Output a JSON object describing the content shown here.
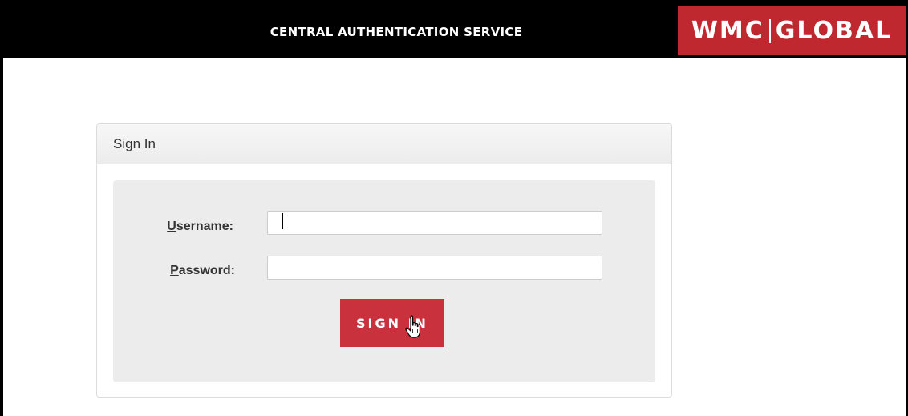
{
  "header": {
    "title": "CENTRAL AUTHENTICATION SERVICE",
    "logo_left": "WMC",
    "logo_right": "GLOBAL",
    "logo_color": "#c0282f"
  },
  "panel": {
    "heading": "Sign In"
  },
  "form": {
    "username_label_key": "U",
    "username_label_rest": "sername:",
    "username_value": "",
    "password_label_key": "P",
    "password_label_rest": "assword:",
    "password_value": "",
    "submit_label": "SIGN IN",
    "button_color": "#c9323c"
  },
  "icons": {
    "cursor": "hand-pointer-icon"
  }
}
